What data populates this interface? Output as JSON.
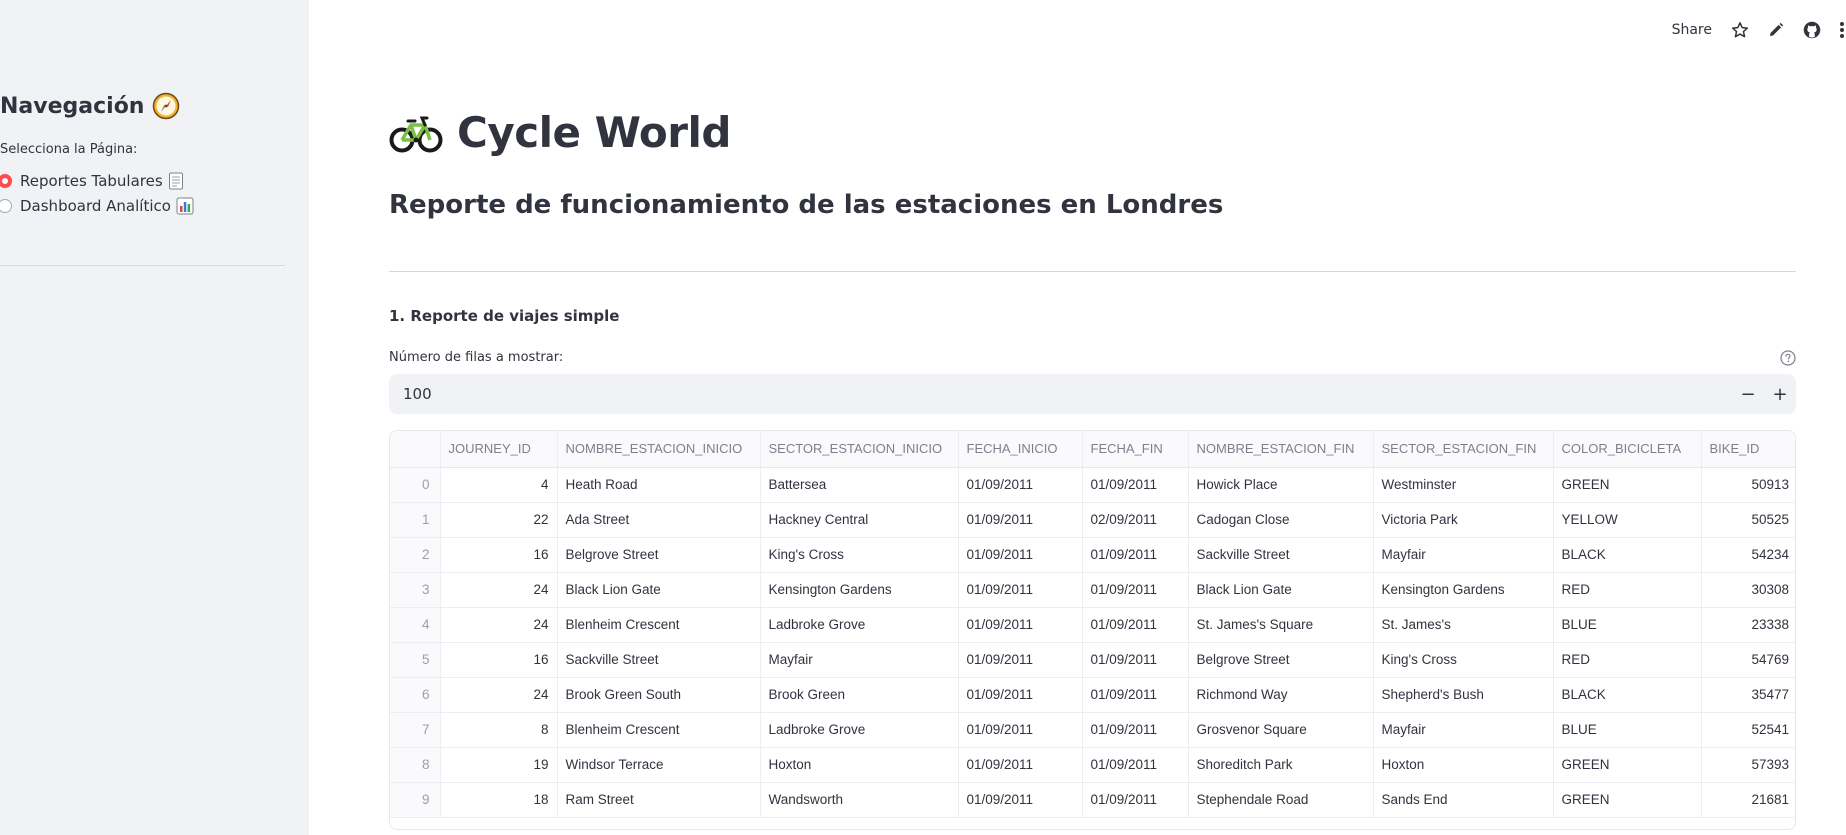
{
  "sidebar": {
    "title": "Navegación",
    "select_label": "Selecciona la Página:",
    "options": [
      {
        "label": "Reportes Tabulares",
        "selected": true,
        "icon": "page-icon"
      },
      {
        "label": "Dashboard Analítico",
        "selected": false,
        "icon": "bar-chart-icon"
      }
    ],
    "title_icon": "compass-icon"
  },
  "toolbar": {
    "share_label": "Share",
    "icons": [
      "star-icon",
      "pencil-icon",
      "github-icon",
      "more-vertical-icon"
    ]
  },
  "header": {
    "app_title": "Cycle World",
    "app_icon": "bicycle-icon",
    "subtitle": "Reporte de funcionamiento de las estaciones en Londres"
  },
  "section": {
    "title": "1. Reporte de viajes simple",
    "rows_label": "Número de filas a mostrar:",
    "rows_value": "100",
    "minus": "−",
    "plus": "+"
  },
  "table": {
    "columns": [
      "JOURNEY_ID",
      "NOMBRE_ESTACION_INICIO",
      "SECTOR_ESTACION_INICIO",
      "FECHA_INICIO",
      "FECHA_FIN",
      "NOMBRE_ESTACION_FIN",
      "SECTOR_ESTACION_FIN",
      "COLOR_BICICLETA",
      "BIKE_ID"
    ],
    "rows": [
      [
        "0",
        "4",
        "Heath Road",
        "Battersea",
        "01/09/2011",
        "01/09/2011",
        "Howick Place",
        "Westminster",
        "GREEN",
        "50913"
      ],
      [
        "1",
        "22",
        "Ada Street",
        "Hackney Central",
        "01/09/2011",
        "02/09/2011",
        "Cadogan Close",
        "Victoria Park",
        "YELLOW",
        "50525"
      ],
      [
        "2",
        "16",
        "Belgrove Street",
        "King's Cross",
        "01/09/2011",
        "01/09/2011",
        "Sackville Street",
        "Mayfair",
        "BLACK",
        "54234"
      ],
      [
        "3",
        "24",
        "Black Lion Gate",
        "Kensington Gardens",
        "01/09/2011",
        "01/09/2011",
        "Black Lion Gate",
        "Kensington Gardens",
        "RED",
        "30308"
      ],
      [
        "4",
        "24",
        "Blenheim Crescent",
        "Ladbroke Grove",
        "01/09/2011",
        "01/09/2011",
        "St. James's Square",
        "St. James's",
        "BLUE",
        "23338"
      ],
      [
        "5",
        "16",
        "Sackville Street",
        "Mayfair",
        "01/09/2011",
        "01/09/2011",
        "Belgrove Street",
        "King's Cross",
        "RED",
        "54769"
      ],
      [
        "6",
        "24",
        "Brook Green South",
        "Brook Green",
        "01/09/2011",
        "01/09/2011",
        "Richmond Way",
        "Shepherd's Bush",
        "BLACK",
        "35477"
      ],
      [
        "7",
        "8",
        "Blenheim Crescent",
        "Ladbroke Grove",
        "01/09/2011",
        "01/09/2011",
        "Grosvenor Square",
        "Mayfair",
        "BLUE",
        "52541"
      ],
      [
        "8",
        "19",
        "Windsor Terrace",
        "Hoxton",
        "01/09/2011",
        "01/09/2011",
        "Shoreditch Park",
        "Hoxton",
        "GREEN",
        "57393"
      ],
      [
        "9",
        "18",
        "Ram Street",
        "Wandsworth",
        "01/09/2011",
        "01/09/2011",
        "Stephendale Road",
        "Sands End",
        "GREEN",
        "21681"
      ]
    ]
  }
}
